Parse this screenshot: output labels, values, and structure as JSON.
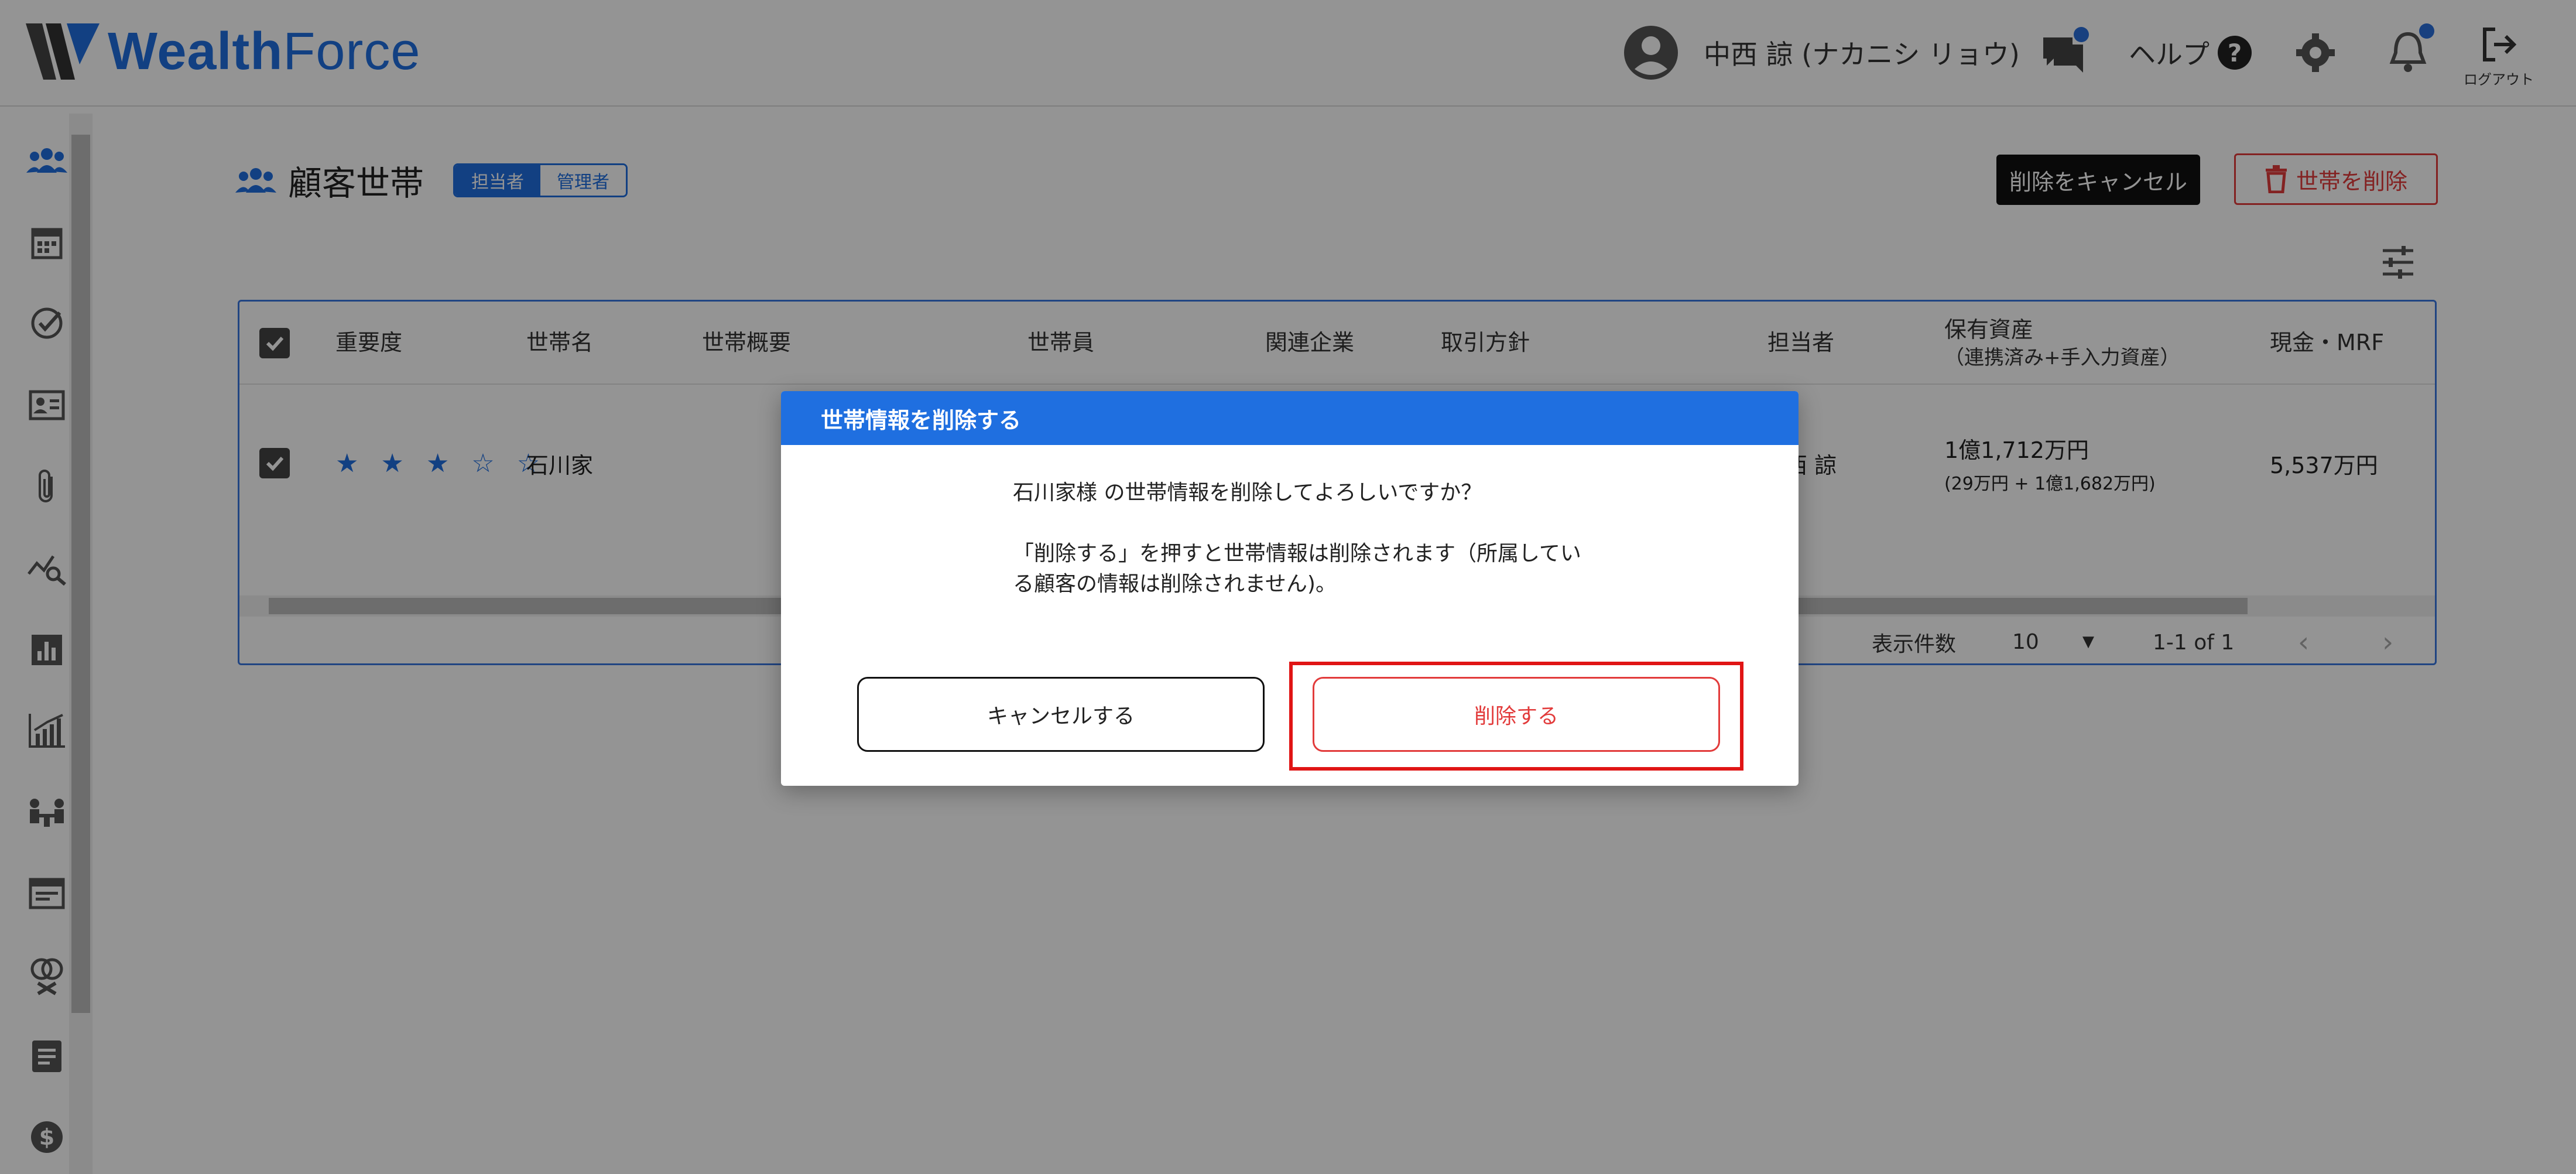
{
  "header": {
    "logo_text_a": "Wealth",
    "logo_text_b": "Force",
    "user_name": "中西 諒 (ナカニシ リョウ)",
    "help_label": "ヘルプ",
    "help_symbol": "?",
    "logout_label": "ログアウト",
    "icons": [
      "user-avatar-icon",
      "chat-icon",
      "gear-icon",
      "bell-icon",
      "logout-icon"
    ]
  },
  "sidebar": {
    "items": [
      "households-icon",
      "calendar-icon",
      "task-check-icon",
      "profile-card-icon",
      "attachment-icon",
      "analysis-icon",
      "bar-chart-icon",
      "growth-chart-icon",
      "meeting-icon",
      "document-window-icon",
      "rings-icon",
      "notes-icon",
      "dollar-icon"
    ]
  },
  "page": {
    "title": "顧客世帯",
    "toggle_on": "担当者",
    "toggle_off": "管理者",
    "cancel_delete_button": "削除をキャンセル",
    "delete_household_button": "世帯を削除"
  },
  "table": {
    "headers": {
      "importance": "重要度",
      "name": "世帯名",
      "summary": "世帯概要",
      "members": "世帯員",
      "companies": "関連企業",
      "policy": "取引方針",
      "owner": "担当者",
      "assets": "保有資産",
      "assets_sub": "（連携済み+手入力資産）",
      "cash": "現金・MRF"
    },
    "row": {
      "stars": "★ ★ ★ ☆ ☆",
      "name": "石川家",
      "owner": "西 諒",
      "assets": "1億1,712万円",
      "assets_sub": "(29万円 + 1億1,682万円)",
      "cash": "5,537万円"
    },
    "pager": {
      "label": "表示件数",
      "per_page": "10",
      "range": "1-1 of 1"
    }
  },
  "dialog": {
    "title": "世帯情報を削除する",
    "message_1": "石川家様 の世帯情報を削除してよろしいですか？",
    "message_2": "「削除する」を押すと世帯情報は削除されます（所属している顧客の情報は削除されません)。",
    "cancel_button": "キャンセルする",
    "delete_button": "削除する"
  },
  "colors": {
    "brand": "#1f6fe0",
    "danger": "#e23b3b",
    "highlight": "#e01515"
  }
}
